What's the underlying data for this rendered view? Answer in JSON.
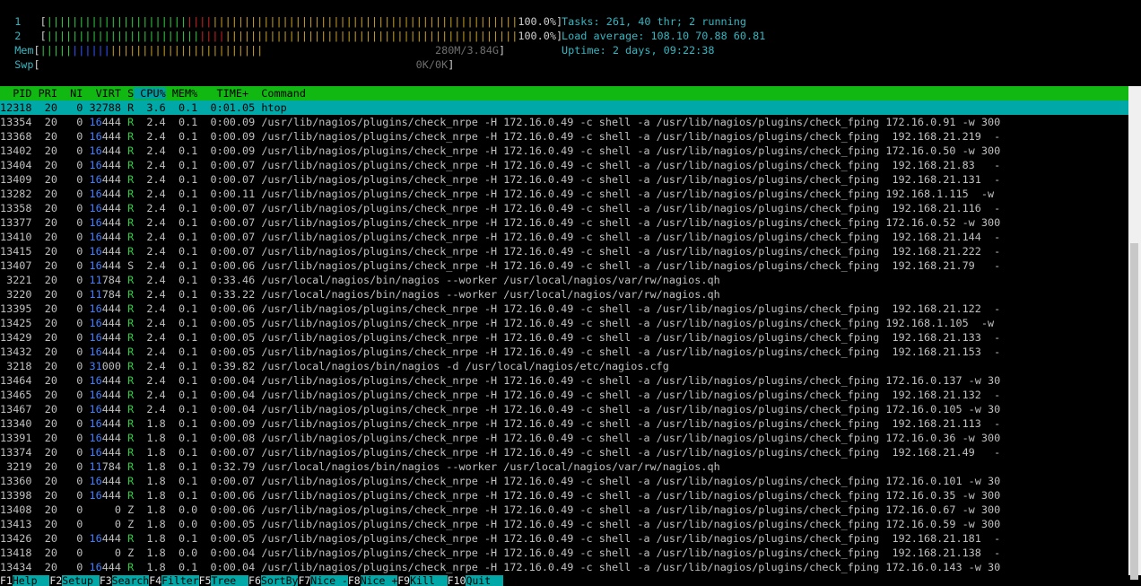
{
  "meters": {
    "cpu1": {
      "label": "  1  ",
      "green": "||||||||||||||||||||||",
      "red": "||||",
      "orange": "||||||||||||||||||||||||||||||||||||||||||||||||",
      "value": "100.0%"
    },
    "cpu2": {
      "label": "  2  ",
      "green": "||||||||||||||||||||||||",
      "red": "||||",
      "orange": "||||||||||||||||||||||||||||||||||||||||||||||",
      "value": "100.0%"
    },
    "mem": {
      "label": "  Mem",
      "green": "|||||",
      "blue": "||||||",
      "orange": "||||||||||||||||||||||||",
      "value": "280M/3.84G"
    },
    "swp": {
      "label": "  Swp",
      "value": "0K/0K"
    }
  },
  "summary": {
    "tasks_label": "Tasks: ",
    "tasks_value": "261, 40 thr; 2 running",
    "load_label": "Load average: ",
    "load_1": "108.10",
    "load_5": "70.88",
    "load_15": "60.81",
    "uptime_label": "Uptime: ",
    "uptime_value": "2 days, 09:22:38"
  },
  "columns": {
    "pid": "  PID",
    "pri": " PRI",
    "ni": "  NI",
    "virt": "  VIRT",
    "s": " S",
    "cpu": " CPU%",
    "mem": " MEM%",
    "time": "   TIME+",
    "command": "  Command"
  },
  "processes": [
    {
      "pid": "12318",
      "pri": "20",
      "ni": "0",
      "virt_hi": "32",
      "virt_lo": "788",
      "s": "R",
      "cpu": "3.6",
      "mem": "0.1",
      "time": "0:01.05",
      "cmd": "htop",
      "selected": true
    },
    {
      "pid": "13354",
      "pri": "20",
      "ni": "0",
      "virt_hi": "16",
      "virt_lo": "444",
      "s": "R",
      "cpu": "2.4",
      "mem": "0.1",
      "time": "0:00.09",
      "cmd": "/usr/lib/nagios/plugins/check_nrpe -H 172.16.0.49 -c shell -a /usr/lib/nagios/plugins/check_fping 172.16.0.91 -w 300"
    },
    {
      "pid": "13368",
      "pri": "20",
      "ni": "0",
      "virt_hi": "16",
      "virt_lo": "444",
      "s": "R",
      "cpu": "2.4",
      "mem": "0.1",
      "time": "0:00.09",
      "cmd": "/usr/lib/nagios/plugins/check_nrpe -H 172.16.0.49 -c shell -a /usr/lib/nagios/plugins/check_fping  192.168.21.219  -"
    },
    {
      "pid": "13402",
      "pri": "20",
      "ni": "0",
      "virt_hi": "16",
      "virt_lo": "444",
      "s": "R",
      "cpu": "2.4",
      "mem": "0.1",
      "time": "0:00.09",
      "cmd": "/usr/lib/nagios/plugins/check_nrpe -H 172.16.0.49 -c shell -a /usr/lib/nagios/plugins/check_fping 172.16.0.50 -w 300"
    },
    {
      "pid": "13404",
      "pri": "20",
      "ni": "0",
      "virt_hi": "16",
      "virt_lo": "444",
      "s": "R",
      "cpu": "2.4",
      "mem": "0.1",
      "time": "0:00.07",
      "cmd": "/usr/lib/nagios/plugins/check_nrpe -H 172.16.0.49 -c shell -a /usr/lib/nagios/plugins/check_fping  192.168.21.83   -"
    },
    {
      "pid": "13409",
      "pri": "20",
      "ni": "0",
      "virt_hi": "16",
      "virt_lo": "444",
      "s": "R",
      "cpu": "2.4",
      "mem": "0.1",
      "time": "0:00.07",
      "cmd": "/usr/lib/nagios/plugins/check_nrpe -H 172.16.0.49 -c shell -a /usr/lib/nagios/plugins/check_fping  192.168.21.131  -"
    },
    {
      "pid": "13282",
      "pri": "20",
      "ni": "0",
      "virt_hi": "16",
      "virt_lo": "444",
      "s": "R",
      "cpu": "2.4",
      "mem": "0.1",
      "time": "0:00.11",
      "cmd": "/usr/lib/nagios/plugins/check_nrpe -H 172.16.0.49 -c shell -a /usr/lib/nagios/plugins/check_fping 192.168.1.115  -w"
    },
    {
      "pid": "13358",
      "pri": "20",
      "ni": "0",
      "virt_hi": "16",
      "virt_lo": "444",
      "s": "R",
      "cpu": "2.4",
      "mem": "0.1",
      "time": "0:00.07",
      "cmd": "/usr/lib/nagios/plugins/check_nrpe -H 172.16.0.49 -c shell -a /usr/lib/nagios/plugins/check_fping  192.168.21.116  -"
    },
    {
      "pid": "13377",
      "pri": "20",
      "ni": "0",
      "virt_hi": "16",
      "virt_lo": "444",
      "s": "R",
      "cpu": "2.4",
      "mem": "0.1",
      "time": "0:00.07",
      "cmd": "/usr/lib/nagios/plugins/check_nrpe -H 172.16.0.49 -c shell -a /usr/lib/nagios/plugins/check_fping 172.16.0.52 -w 300"
    },
    {
      "pid": "13410",
      "pri": "20",
      "ni": "0",
      "virt_hi": "16",
      "virt_lo": "444",
      "s": "R",
      "cpu": "2.4",
      "mem": "0.1",
      "time": "0:00.07",
      "cmd": "/usr/lib/nagios/plugins/check_nrpe -H 172.16.0.49 -c shell -a /usr/lib/nagios/plugins/check_fping  192.168.21.144  -"
    },
    {
      "pid": "13415",
      "pri": "20",
      "ni": "0",
      "virt_hi": "16",
      "virt_lo": "444",
      "s": "R",
      "cpu": "2.4",
      "mem": "0.1",
      "time": "0:00.07",
      "cmd": "/usr/lib/nagios/plugins/check_nrpe -H 172.16.0.49 -c shell -a /usr/lib/nagios/plugins/check_fping  192.168.21.222  -"
    },
    {
      "pid": "13407",
      "pri": "20",
      "ni": "0",
      "virt_hi": "16",
      "virt_lo": "444",
      "s": "S",
      "cpu": "2.4",
      "mem": "0.1",
      "time": "0:00.06",
      "cmd": "/usr/lib/nagios/plugins/check_nrpe -H 172.16.0.49 -c shell -a /usr/lib/nagios/plugins/check_fping  192.168.21.79   -"
    },
    {
      "pid": "3221",
      "pri": "20",
      "ni": "0",
      "virt_hi": "11",
      "virt_lo": "784",
      "s": "R",
      "cpu": "2.4",
      "mem": "0.1",
      "time": "0:33.46",
      "cmd": "/usr/local/nagios/bin/nagios --worker /usr/local/nagios/var/rw/nagios.qh"
    },
    {
      "pid": "3220",
      "pri": "20",
      "ni": "0",
      "virt_hi": "11",
      "virt_lo": "784",
      "s": "R",
      "cpu": "2.4",
      "mem": "0.1",
      "time": "0:33.22",
      "cmd": "/usr/local/nagios/bin/nagios --worker /usr/local/nagios/var/rw/nagios.qh"
    },
    {
      "pid": "13395",
      "pri": "20",
      "ni": "0",
      "virt_hi": "16",
      "virt_lo": "444",
      "s": "R",
      "cpu": "2.4",
      "mem": "0.1",
      "time": "0:00.06",
      "cmd": "/usr/lib/nagios/plugins/check_nrpe -H 172.16.0.49 -c shell -a /usr/lib/nagios/plugins/check_fping  192.168.21.122  -"
    },
    {
      "pid": "13425",
      "pri": "20",
      "ni": "0",
      "virt_hi": "16",
      "virt_lo": "444",
      "s": "R",
      "cpu": "2.4",
      "mem": "0.1",
      "time": "0:00.05",
      "cmd": "/usr/lib/nagios/plugins/check_nrpe -H 172.16.0.49 -c shell -a /usr/lib/nagios/plugins/check_fping 192.168.1.105  -w"
    },
    {
      "pid": "13429",
      "pri": "20",
      "ni": "0",
      "virt_hi": "16",
      "virt_lo": "444",
      "s": "R",
      "cpu": "2.4",
      "mem": "0.1",
      "time": "0:00.05",
      "cmd": "/usr/lib/nagios/plugins/check_nrpe -H 172.16.0.49 -c shell -a /usr/lib/nagios/plugins/check_fping  192.168.21.133  -"
    },
    {
      "pid": "13432",
      "pri": "20",
      "ni": "0",
      "virt_hi": "16",
      "virt_lo": "444",
      "s": "R",
      "cpu": "2.4",
      "mem": "0.1",
      "time": "0:00.05",
      "cmd": "/usr/lib/nagios/plugins/check_nrpe -H 172.16.0.49 -c shell -a /usr/lib/nagios/plugins/check_fping  192.168.21.153  -"
    },
    {
      "pid": "3218",
      "pri": "20",
      "ni": "0",
      "virt_hi": "31",
      "virt_lo": "000",
      "s": "R",
      "cpu": "2.4",
      "mem": "0.1",
      "time": "0:39.82",
      "cmd": "/usr/local/nagios/bin/nagios -d /usr/local/nagios/etc/nagios.cfg"
    },
    {
      "pid": "13464",
      "pri": "20",
      "ni": "0",
      "virt_hi": "16",
      "virt_lo": "444",
      "s": "R",
      "cpu": "2.4",
      "mem": "0.1",
      "time": "0:00.04",
      "cmd": "/usr/lib/nagios/plugins/check_nrpe -H 172.16.0.49 -c shell -a /usr/lib/nagios/plugins/check_fping 172.16.0.137 -w 30"
    },
    {
      "pid": "13465",
      "pri": "20",
      "ni": "0",
      "virt_hi": "16",
      "virt_lo": "444",
      "s": "R",
      "cpu": "2.4",
      "mem": "0.1",
      "time": "0:00.04",
      "cmd": "/usr/lib/nagios/plugins/check_nrpe -H 172.16.0.49 -c shell -a /usr/lib/nagios/plugins/check_fping  192.168.21.132  -"
    },
    {
      "pid": "13467",
      "pri": "20",
      "ni": "0",
      "virt_hi": "16",
      "virt_lo": "444",
      "s": "R",
      "cpu": "2.4",
      "mem": "0.1",
      "time": "0:00.04",
      "cmd": "/usr/lib/nagios/plugins/check_nrpe -H 172.16.0.49 -c shell -a /usr/lib/nagios/plugins/check_fping 172.16.0.105 -w 30"
    },
    {
      "pid": "13340",
      "pri": "20",
      "ni": "0",
      "virt_hi": "16",
      "virt_lo": "444",
      "s": "R",
      "cpu": "1.8",
      "mem": "0.1",
      "time": "0:00.09",
      "cmd": "/usr/lib/nagios/plugins/check_nrpe -H 172.16.0.49 -c shell -a /usr/lib/nagios/plugins/check_fping  192.168.21.113  -"
    },
    {
      "pid": "13391",
      "pri": "20",
      "ni": "0",
      "virt_hi": "16",
      "virt_lo": "444",
      "s": "R",
      "cpu": "1.8",
      "mem": "0.1",
      "time": "0:00.08",
      "cmd": "/usr/lib/nagios/plugins/check_nrpe -H 172.16.0.49 -c shell -a /usr/lib/nagios/plugins/check_fping 172.16.0.36 -w 300"
    },
    {
      "pid": "13374",
      "pri": "20",
      "ni": "0",
      "virt_hi": "16",
      "virt_lo": "444",
      "s": "R",
      "cpu": "1.8",
      "mem": "0.1",
      "time": "0:00.07",
      "cmd": "/usr/lib/nagios/plugins/check_nrpe -H 172.16.0.49 -c shell -a /usr/lib/nagios/plugins/check_fping  192.168.21.49   -"
    },
    {
      "pid": "3219",
      "pri": "20",
      "ni": "0",
      "virt_hi": "11",
      "virt_lo": "784",
      "s": "R",
      "cpu": "1.8",
      "mem": "0.1",
      "time": "0:32.79",
      "cmd": "/usr/local/nagios/bin/nagios --worker /usr/local/nagios/var/rw/nagios.qh"
    },
    {
      "pid": "13360",
      "pri": "20",
      "ni": "0",
      "virt_hi": "16",
      "virt_lo": "444",
      "s": "R",
      "cpu": "1.8",
      "mem": "0.1",
      "time": "0:00.07",
      "cmd": "/usr/lib/nagios/plugins/check_nrpe -H 172.16.0.49 -c shell -a /usr/lib/nagios/plugins/check_fping 172.16.0.101 -w 30"
    },
    {
      "pid": "13398",
      "pri": "20",
      "ni": "0",
      "virt_hi": "16",
      "virt_lo": "444",
      "s": "R",
      "cpu": "1.8",
      "mem": "0.1",
      "time": "0:00.06",
      "cmd": "/usr/lib/nagios/plugins/check_nrpe -H 172.16.0.49 -c shell -a /usr/lib/nagios/plugins/check_fping 172.16.0.35 -w 300"
    },
    {
      "pid": "13408",
      "pri": "20",
      "ni": "0",
      "virt_hi": "",
      "virt_lo": "0",
      "s": "Z",
      "cpu": "1.8",
      "mem": "0.0",
      "time": "0:00.06",
      "cmd": "/usr/lib/nagios/plugins/check_nrpe -H 172.16.0.49 -c shell -a /usr/lib/nagios/plugins/check_fping 172.16.0.67 -w 300"
    },
    {
      "pid": "13413",
      "pri": "20",
      "ni": "0",
      "virt_hi": "",
      "virt_lo": "0",
      "s": "Z",
      "cpu": "1.8",
      "mem": "0.0",
      "time": "0:00.05",
      "cmd": "/usr/lib/nagios/plugins/check_nrpe -H 172.16.0.49 -c shell -a /usr/lib/nagios/plugins/check_fping 172.16.0.59 -w 300"
    },
    {
      "pid": "13426",
      "pri": "20",
      "ni": "0",
      "virt_hi": "16",
      "virt_lo": "444",
      "s": "R",
      "cpu": "1.8",
      "mem": "0.1",
      "time": "0:00.05",
      "cmd": "/usr/lib/nagios/plugins/check_nrpe -H 172.16.0.49 -c shell -a /usr/lib/nagios/plugins/check_fping  192.168.21.181  -"
    },
    {
      "pid": "13418",
      "pri": "20",
      "ni": "0",
      "virt_hi": "",
      "virt_lo": "0",
      "s": "Z",
      "cpu": "1.8",
      "mem": "0.0",
      "time": "0:00.04",
      "cmd": "/usr/lib/nagios/plugins/check_nrpe -H 172.16.0.49 -c shell -a /usr/lib/nagios/plugins/check_fping  192.168.21.138  -"
    },
    {
      "pid": "13434",
      "pri": "20",
      "ni": "0",
      "virt_hi": "16",
      "virt_lo": "444",
      "s": "R",
      "cpu": "1.8",
      "mem": "0.1",
      "time": "0:00.04",
      "cmd": "/usr/lib/nagios/plugins/check_nrpe -H 172.16.0.49 -c shell -a /usr/lib/nagios/plugins/check_fping 172.16.0.143 -w 30"
    }
  ],
  "footer": [
    {
      "key": "F1",
      "label": "Help  "
    },
    {
      "key": "F2",
      "label": "Setup "
    },
    {
      "key": "F3",
      "label": "Search"
    },
    {
      "key": "F4",
      "label": "Filter"
    },
    {
      "key": "F5",
      "label": "Tree  "
    },
    {
      "key": "F6",
      "label": "SortBy"
    },
    {
      "key": "F7",
      "label": "Nice -"
    },
    {
      "key": "F8",
      "label": "Nice +"
    },
    {
      "key": "F9",
      "label": "Kill  "
    },
    {
      "key": "F10",
      "label": "Quit  "
    }
  ],
  "colors": {
    "header_bg": "#12b812",
    "selected_bg": "#00a8a8",
    "sort_col_bg": "#00a0a0",
    "cyan_text": "#36b5c0"
  }
}
